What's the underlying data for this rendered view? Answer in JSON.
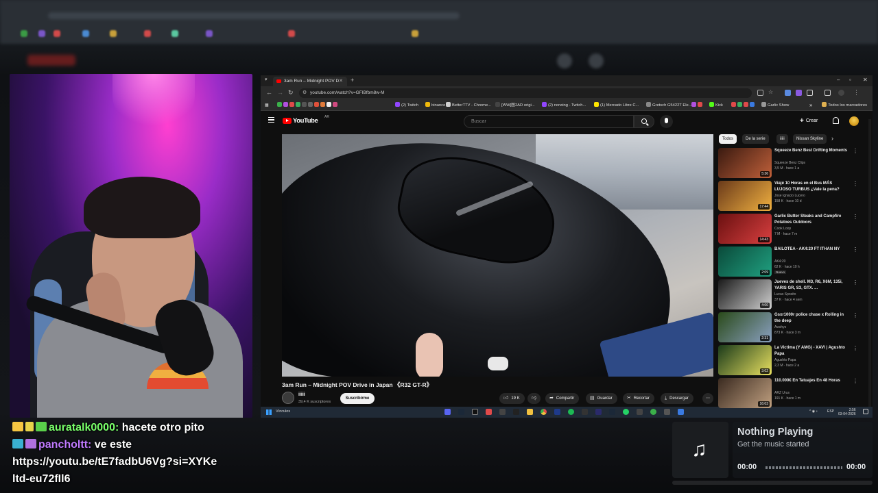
{
  "browser": {
    "tab_title": "3am Run – Midnight POV D",
    "url": "youtube.com/watch?v=GFIBfbm8w-M",
    "bookmarks": [
      "(2) Twitch",
      "binance",
      "BetterTTV - Chrome...",
      "[WW]图2AD origi...",
      "(2) norwing - Twitch...",
      "(1) Mercado Libre C...",
      "Gretsch G5422T Ele...",
      "Kick",
      "Garlic Show"
    ],
    "all_bookmarks": "Todos los marcadores"
  },
  "youtube": {
    "logo_text": "YouTube",
    "country": "AR",
    "search_placeholder": "Buscar",
    "create_label": "Crear",
    "video": {
      "title": "3am Run – Midnight POV Drive in Japan 《R32 GT-R》",
      "channel": "iiiii",
      "subscribers": "39,4 K suscriptores",
      "subscribe_label": "Suscribirme",
      "likes": "19 K",
      "share_label": "Compartir",
      "save_label": "Guardar",
      "clip_label": "Recortar",
      "download_label": "Descargar"
    },
    "chips": [
      "Todos",
      "De la serie",
      "iiiii",
      "Nissan Skyline"
    ],
    "recommendations": [
      {
        "title": "Squeeze Benz Best Drifting Moments",
        "channel": "Squeeze Benz Clips",
        "meta": "3,5 M · hace 1 a",
        "duration": "5:36",
        "thumb": [
          "#3a1a10",
          "#c0603a"
        ]
      },
      {
        "title": "Viajé 10 Horas en el Bus MÁS LUJOSO TURBUS ¿Vale la pena?",
        "channel": "Jose Ignacio Lucero",
        "meta": "158 K · hace 10 d",
        "duration": "17:44",
        "thumb": [
          "#6a3a1a",
          "#f0b040"
        ]
      },
      {
        "title": "Garlic Butter Steaks and Campfire Potatoes Outdoors",
        "channel": "Cook Loop",
        "meta": "7 M · hace 7 m",
        "duration": "14:43",
        "thumb": [
          "#6a1010",
          "#d94040"
        ]
      },
      {
        "title": "BAILOTEA - AK4:20 FT ITHAN NY",
        "channel": "AK4:20",
        "meta": "62 K · hace 10 h",
        "badge": "Nuevo",
        "duration": "2:09",
        "thumb": [
          "#0a4a3a",
          "#20a080"
        ]
      },
      {
        "title": "Jueves de shell. M3, R6, X6M, 135i, YARIS GR, S3, GTX. ...",
        "channel": "Lucas Sposito",
        "meta": "37 K · hace 4 sem",
        "duration": "4:00",
        "thumb": [
          "#1a1a1a",
          "#d0d0d0"
        ]
      },
      {
        "title": "Gsxr1000r police chase x Rolling in the deep",
        "channel": "Awshys",
        "meta": "873 K · hace 3 m",
        "duration": "2:31",
        "thumb": [
          "#2a4a1a",
          "#8aa0c0"
        ]
      },
      {
        "title": "La Victima (Y AMG) - XAVI | Agushto Papa",
        "channel": "Agushto Papa",
        "meta": "2,3 M · hace 2 a",
        "duration": "3:02",
        "thumb": [
          "#1a3a1a",
          "#e8e060"
        ]
      },
      {
        "title": "110.000€ En Tatuajes En 48 Horas",
        "channel": "ARZ Urus",
        "meta": "191 K · hace 1 m",
        "duration": "16:03",
        "thumb": [
          "#3a2a20",
          "#c0a080"
        ]
      }
    ]
  },
  "taskbar": {
    "links_label": "Vínculos",
    "lang": "ESP",
    "time": "2:56",
    "date": "03-04-2026"
  },
  "chat": [
    {
      "user": "auratalk0000:",
      "message": "hacete otro pito",
      "color": "#79ff6a"
    },
    {
      "user": "pancholtt:",
      "message": "ve este",
      "color": "#c07aff"
    }
  ],
  "chat_link": "https://youtu.be/tE7fadbU6Vg?si=XYKeltd-eu72fIl6",
  "music": {
    "title": "Nothing Playing",
    "subtitle": "Get the music started",
    "time_current": "00:00",
    "time_total": "00:00"
  }
}
